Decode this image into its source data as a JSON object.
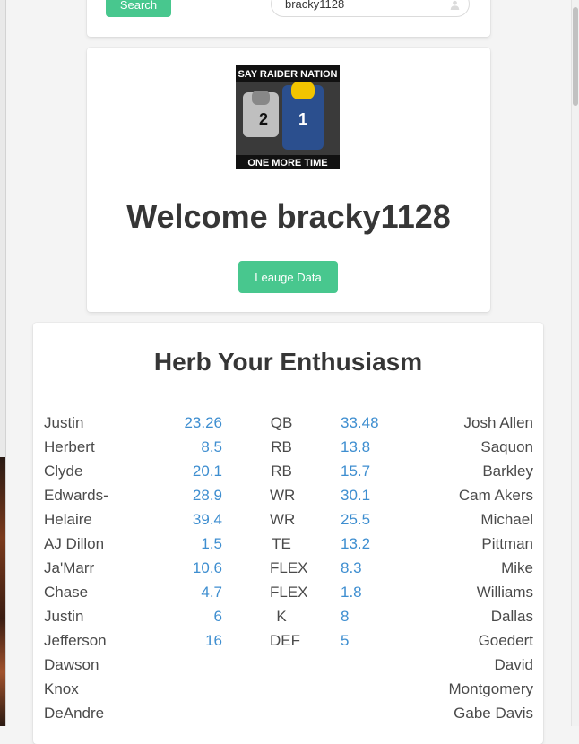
{
  "search": {
    "button_label": "Search",
    "input_value": "bracky1128"
  },
  "welcome": {
    "logo_text_top": "SAY RAIDER NATION",
    "logo_text_bottom": "ONE MORE TIME",
    "jersey_left": "2",
    "jersey_right": "1",
    "title": "Welcome bracky1128",
    "league_button_label": "Leauge Data"
  },
  "team": {
    "name": "Herb Your Enthusiasm",
    "rows": [
      {
        "left_name": "Justin",
        "left_score": "23.26",
        "pos": "QB",
        "right_score": "33.48",
        "right_name": "Josh Allen"
      },
      {
        "left_name": "Herbert",
        "left_score": "8.5",
        "pos": "RB",
        "right_score": "13.8",
        "right_name": "Saquon"
      },
      {
        "left_name": "Clyde",
        "left_score": "20.1",
        "pos": "RB",
        "right_score": "15.7",
        "right_name": "Barkley"
      },
      {
        "left_name": "Edwards-",
        "left_score": "28.9",
        "pos": "WR",
        "right_score": "30.1",
        "right_name": "Cam Akers"
      },
      {
        "left_name": "Helaire",
        "left_score": "39.4",
        "pos": "WR",
        "right_score": "25.5",
        "right_name": "Michael"
      },
      {
        "left_name": "AJ Dillon",
        "left_score": "1.5",
        "pos": "TE",
        "right_score": "13.2",
        "right_name": "Pittman"
      },
      {
        "left_name": "Ja'Marr",
        "left_score": "10.6",
        "pos": "FLEX",
        "right_score": "8.3",
        "right_name": "Mike"
      },
      {
        "left_name": "Chase",
        "left_score": "4.7",
        "pos": "FLEX",
        "right_score": "1.8",
        "right_name": "Williams"
      },
      {
        "left_name": "Justin",
        "left_score": "6",
        "pos": "K",
        "right_score": "8",
        "right_name": "Dallas"
      },
      {
        "left_name": "Jefferson",
        "left_score": "16",
        "pos": "DEF",
        "right_score": "5",
        "right_name": "Goedert"
      },
      {
        "left_name": "Dawson",
        "left_score": "",
        "pos": "",
        "right_score": "",
        "right_name": "David"
      },
      {
        "left_name": "Knox",
        "left_score": "",
        "pos": "",
        "right_score": "",
        "right_name": "Montgomery"
      },
      {
        "left_name": "DeAndre",
        "left_score": "",
        "pos": "",
        "right_score": "",
        "right_name": "Gabe Davis"
      }
    ]
  },
  "colors": {
    "primary_button": "#48c78e",
    "score_text": "#3e8ed0",
    "heading_text": "#363636"
  }
}
